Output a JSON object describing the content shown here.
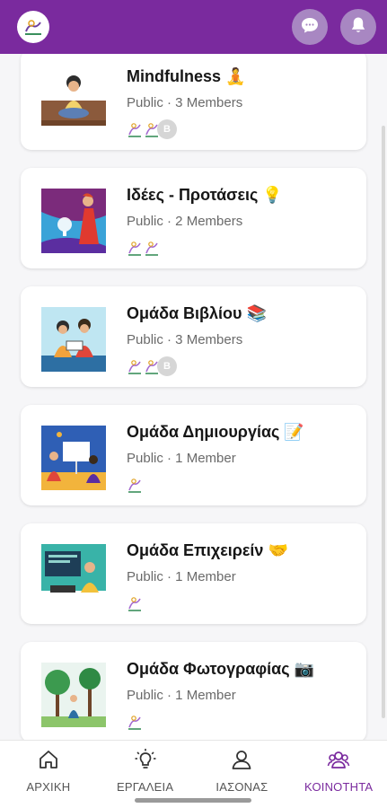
{
  "header": {
    "logo_icon": "app-logo-icon",
    "chat_icon": "chat-bubble-icon",
    "bell_icon": "bell-icon",
    "bg_color": "#7a2a9e"
  },
  "groups": [
    {
      "title": "Mindfulness 🧘",
      "meta": "Public · 3 Members",
      "extra_avatar": "B",
      "thumb_icon": "woman-meditating-illustration"
    },
    {
      "title": "Ιδέες - Προτάσεις 💡",
      "meta": "Public · 2 Members",
      "extra_avatar": "",
      "thumb_icon": "woman-lightbulb-illustration"
    },
    {
      "title": "Ομάδα Βιβλίου 📚",
      "meta": "Public · 3 Members",
      "extra_avatar": "B",
      "thumb_icon": "people-reading-illustration"
    },
    {
      "title": "Ομάδα Δημιουργίας 📝",
      "meta": "Public · 1 Member",
      "extra_avatar": "",
      "thumb_icon": "presentation-illustration"
    },
    {
      "title": "Ομάδα Επιχειρείν 🤝",
      "meta": "Public · 1 Member",
      "extra_avatar": "",
      "thumb_icon": "man-laptop-illustration"
    },
    {
      "title": "Ομάδα Φωτογραφίας 📷",
      "meta": "Public · 1 Member",
      "extra_avatar": "",
      "thumb_icon": "park-photography-illustration"
    }
  ],
  "nav": {
    "items": [
      {
        "label": "ΑΡΧΙΚΗ",
        "icon": "home-icon"
      },
      {
        "label": "ΕΡΓΑΛΕΙΑ",
        "icon": "lightbulb-icon"
      },
      {
        "label": "ΙΑΣΟΝΑΣ",
        "icon": "person-icon"
      },
      {
        "label": "ΚΟΙΝΟΤΗΤΑ",
        "icon": "community-icon"
      }
    ],
    "active_color": "#7a2a9e"
  }
}
